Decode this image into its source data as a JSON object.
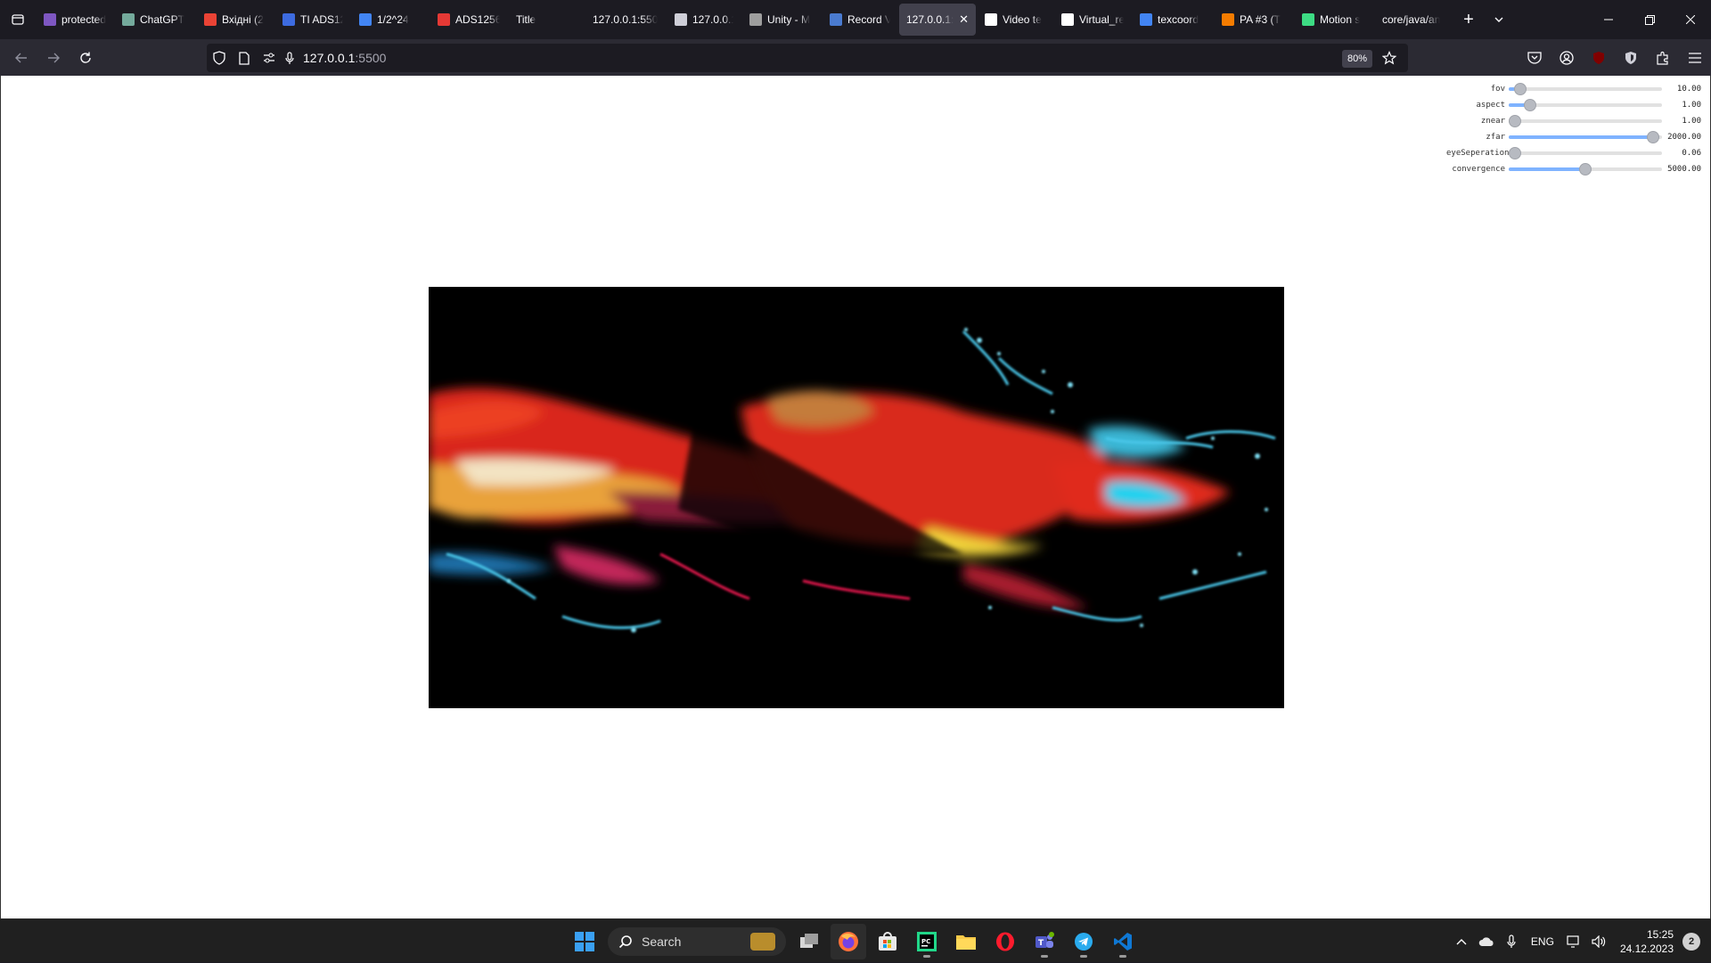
{
  "browser": {
    "tabs": [
      {
        "title": "protected",
        "favicon": "h-icon",
        "color": "#7e57c2"
      },
      {
        "title": "ChatGPT",
        "favicon": "chatgpt-icon",
        "color": "#74aa9c"
      },
      {
        "title": "Вхідні (2",
        "favicon": "gmail-icon",
        "color": "#ea4335"
      },
      {
        "title": "TI ADS12",
        "favicon": "rc-icon",
        "color": "#3d6be0"
      },
      {
        "title": "1/2^24 ",
        "favicon": "google-icon",
        "color": "#4285f4"
      },
      {
        "title": "ADS1256",
        "favicon": "pin-icon",
        "color": "#e53935"
      },
      {
        "title": "Title",
        "favicon": "",
        "color": ""
      },
      {
        "title": "127.0.0.1:550",
        "favicon": "",
        "color": ""
      },
      {
        "title": "127.0.0.1",
        "favicon": "globe-icon",
        "color": "#cfcfd8"
      },
      {
        "title": "Unity - M",
        "favicon": "unity-icon",
        "color": "#9e9e9e"
      },
      {
        "title": "Record V",
        "favicon": "record-icon",
        "color": "#4a7bd0"
      },
      {
        "title": "127.0.0.1:5",
        "favicon": "",
        "color": "",
        "active": true
      },
      {
        "title": "Video te",
        "favicon": "medium-icon",
        "color": "#ffffff"
      },
      {
        "title": "Virtual_re",
        "favicon": "github-icon",
        "color": "#ffffff"
      },
      {
        "title": "texcoord",
        "favicon": "google-icon",
        "color": "#4285f4"
      },
      {
        "title": "PA #3 (T",
        "favicon": "blogger-icon",
        "color": "#f57c00"
      },
      {
        "title": "Motion s",
        "favicon": "android-icon",
        "color": "#3ddc84"
      },
      {
        "title": "core/java/an",
        "favicon": "",
        "color": ""
      }
    ],
    "url_host": "127.0.0.1",
    "url_port": ":5500",
    "zoom": "80%"
  },
  "gui": {
    "controls": [
      {
        "label": "fov",
        "value": "10.00",
        "fraction": 0.04
      },
      {
        "label": "aspect",
        "value": "1.00",
        "fraction": 0.11
      },
      {
        "label": "znear",
        "value": "1.00",
        "fraction": 0.0
      },
      {
        "label": "zfar",
        "value": "2000.00",
        "fraction": 0.98
      },
      {
        "label": "eyeSeperation",
        "value": "0.06",
        "fraction": 0.0
      },
      {
        "label": "convergence",
        "value": "5000.00",
        "fraction": 0.5
      }
    ]
  },
  "taskbar": {
    "search_label": "Search",
    "language": "ENG",
    "time": "15:25",
    "date": "24.12.2023",
    "notifications": "2"
  }
}
